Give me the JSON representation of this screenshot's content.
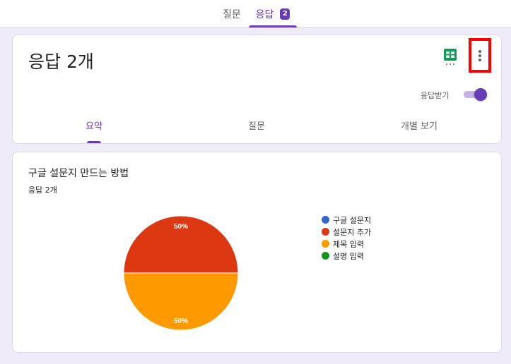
{
  "top_tabs": {
    "questions_label": "질문",
    "responses_label": "응답",
    "responses_badge": "2"
  },
  "summary_card": {
    "title": "응답 2개",
    "accepting_label": "응답받기",
    "accepting_on": true,
    "tabs": [
      "요약",
      "질문",
      "개별 보기"
    ],
    "active_tab": "요약"
  },
  "question_card": {
    "title": "구글 설문지 만드는 방법",
    "response_count": "응답 2개"
  },
  "colors": {
    "accent": "#673ab7",
    "slice_blue": "#3366cc",
    "slice_red": "#dc3912",
    "slice_orange": "#ff9900",
    "slice_green": "#109618",
    "highlight_box": "#ff0000"
  },
  "chart_data": {
    "type": "pie",
    "categories": [
      "구글 설문지",
      "설문지 추가",
      "제목 입력",
      "설명 입력"
    ],
    "values": [
      0,
      50,
      50,
      0
    ],
    "data_labels": [
      "",
      "50%",
      "50%",
      ""
    ],
    "colors": [
      "#3366cc",
      "#dc3912",
      "#ff9900",
      "#109618"
    ],
    "legend": "right"
  }
}
